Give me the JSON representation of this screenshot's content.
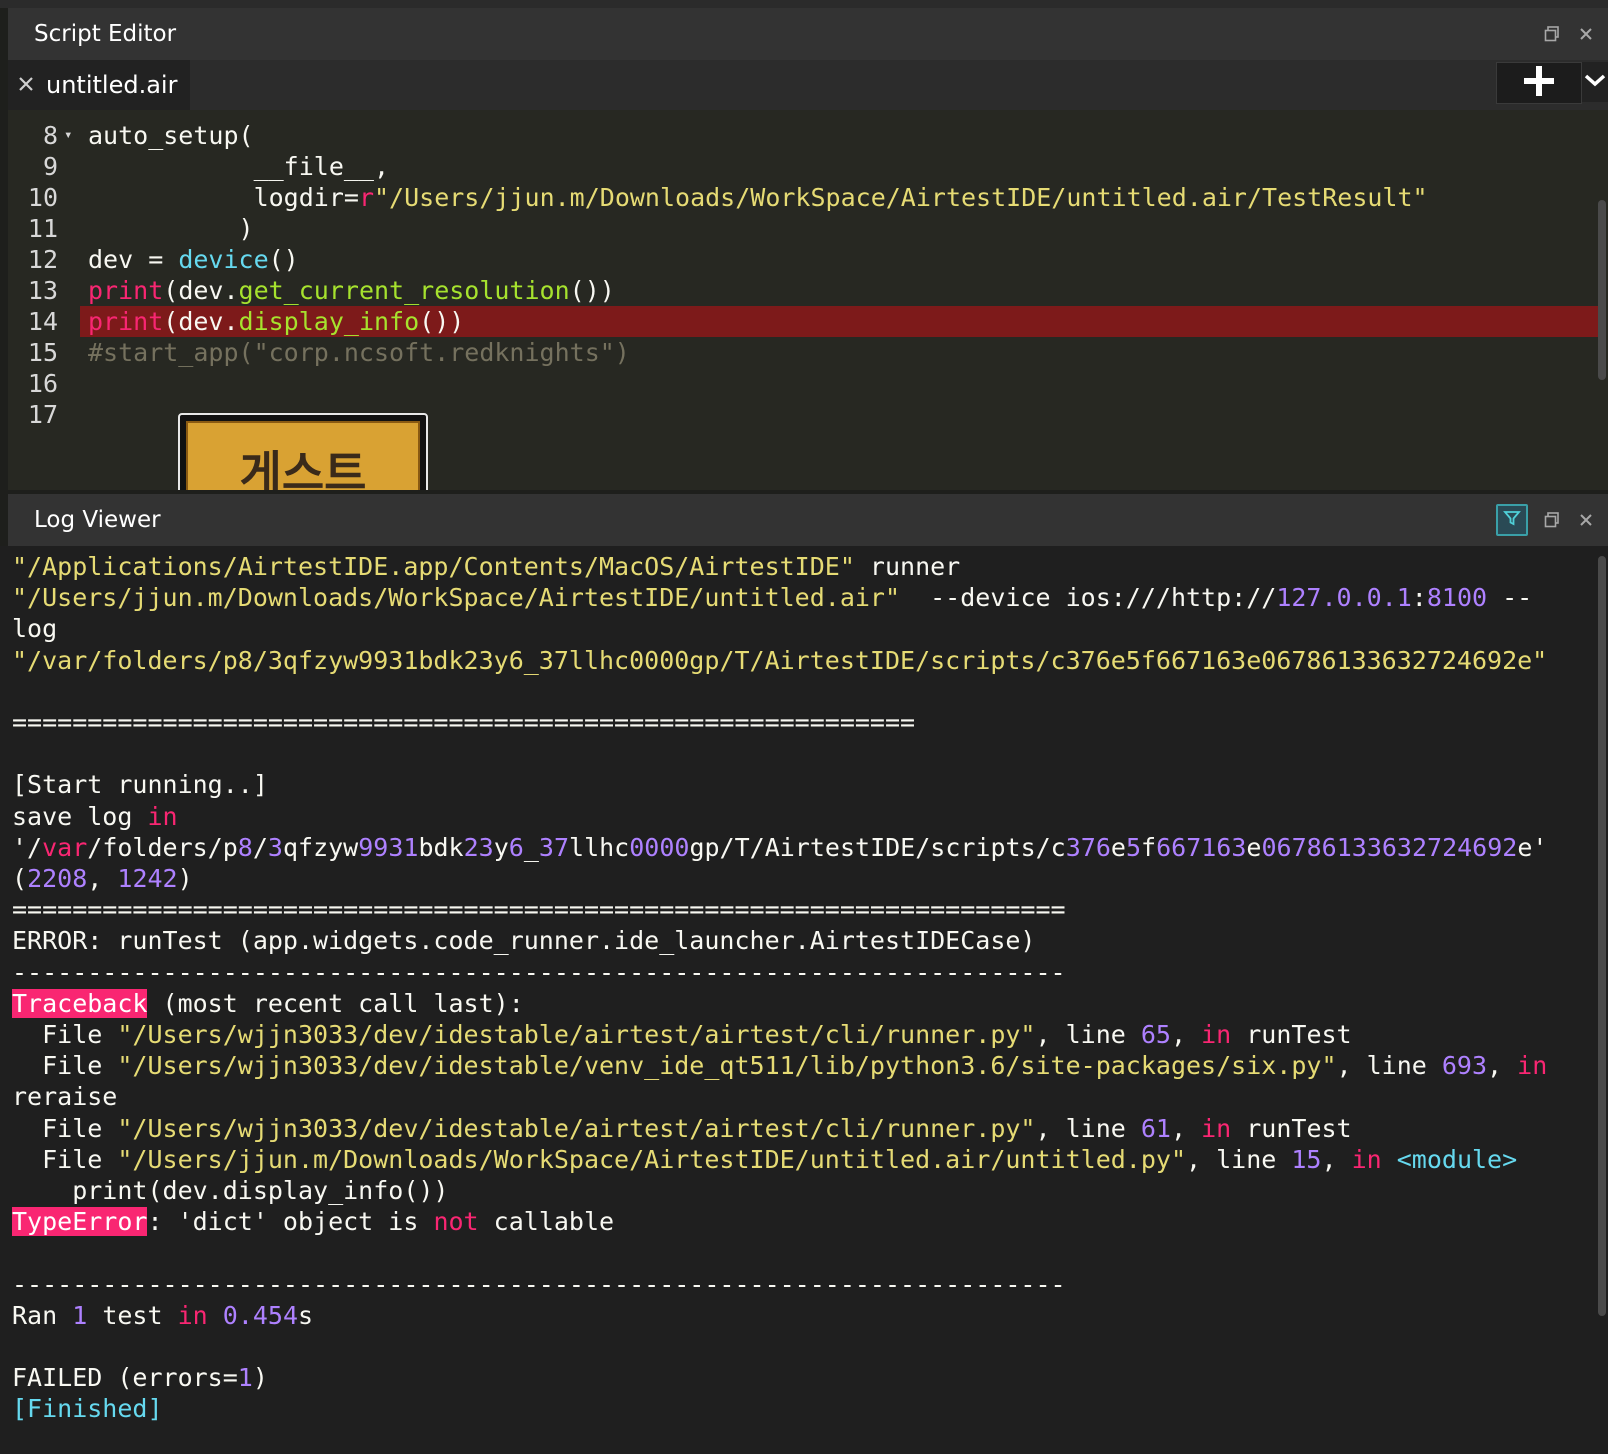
{
  "window": {
    "script_editor_title": "Script Editor",
    "log_viewer_title": "Log Viewer"
  },
  "editor": {
    "tab_label": "untitled.air",
    "lines": [
      {
        "num": "8",
        "fold": "▾",
        "tokens": [
          [
            "c-plain",
            "auto_setup("
          ]
        ]
      },
      {
        "num": "9",
        "tokens": [
          [
            "c-plain",
            "           __file__,"
          ]
        ]
      },
      {
        "num": "10",
        "tokens": [
          [
            "c-plain",
            "           logdir="
          ],
          [
            "c-kw",
            "r"
          ],
          [
            "c-str",
            "\"/Users/jjun.m/Downloads/WorkSpace/AirtestIDE/untitled.air/TestResult\""
          ]
        ]
      },
      {
        "num": "11",
        "tokens": [
          [
            "c-plain",
            "          )"
          ]
        ]
      },
      {
        "num": "12",
        "tokens": [
          [
            "c-plain",
            "dev = "
          ],
          [
            "c-bi",
            "device"
          ],
          [
            "c-plain",
            "()"
          ]
        ]
      },
      {
        "num": "13",
        "tokens": [
          [
            "c-kw",
            "print"
          ],
          [
            "c-plain",
            "(dev."
          ],
          [
            "c-fn",
            "get_current_resolution"
          ],
          [
            "c-plain",
            "())"
          ]
        ]
      },
      {
        "num": "14",
        "highlight": true,
        "tokens": [
          [
            "c-kw",
            "print"
          ],
          [
            "c-plain",
            "(dev."
          ],
          [
            "c-fn",
            "display_info"
          ],
          [
            "c-plain",
            "())"
          ]
        ]
      },
      {
        "num": "15",
        "tokens": [
          [
            "c-cmt",
            "#start_app(\"corp.ncsoft.redknights\")"
          ]
        ]
      },
      {
        "num": "16",
        "tokens": []
      },
      {
        "num": "17",
        "tokens": []
      }
    ],
    "image_preview_text": "게스트"
  },
  "log": {
    "lines": [
      [
        [
          "l-str",
          "\"/Applications/AirtestIDE.app/Contents/MacOS/AirtestIDE\""
        ],
        [
          "",
          " runner"
        ]
      ],
      [
        [
          "l-str",
          "\"/Users/jjun.m/Downloads/WorkSpace/AirtestIDE/untitled.air\""
        ],
        [
          "",
          "  --device ios:///http://"
        ],
        [
          "l-num",
          "127.0.0.1"
        ],
        [
          "",
          ":"
        ],
        [
          "l-num",
          "8100"
        ],
        [
          "",
          " --"
        ]
      ],
      [
        [
          "",
          "log"
        ]
      ],
      [
        [
          "l-str",
          "\"/var/folders/p8/3qfzyw9931bdk23y6_37llhc0000gp/T/AirtestIDE/scripts/c376e5f667163e06786133632724692e\""
        ]
      ],
      [],
      [
        [
          "",
          "============================================================"
        ]
      ],
      [],
      [
        [
          "",
          "[Start running..]"
        ]
      ],
      [
        [
          "",
          "save log "
        ],
        [
          "l-kw",
          "in"
        ]
      ],
      [
        [
          "",
          "'/"
        ],
        [
          "l-kw",
          "var"
        ],
        [
          "",
          "/folders/p"
        ],
        [
          "l-num",
          "8"
        ],
        [
          "",
          "/"
        ],
        [
          "l-num",
          "3"
        ],
        [
          "",
          "qfzyw"
        ],
        [
          "l-num",
          "9931"
        ],
        [
          "",
          "bdk"
        ],
        [
          "l-num",
          "23"
        ],
        [
          "",
          "y"
        ],
        [
          "l-num",
          "6"
        ],
        [
          "",
          "_"
        ],
        [
          "l-num",
          "37"
        ],
        [
          "",
          "llhc"
        ],
        [
          "l-num",
          "0000"
        ],
        [
          "",
          "gp/T/AirtestIDE/scripts/c"
        ],
        [
          "l-num",
          "376"
        ],
        [
          "",
          "e"
        ],
        [
          "l-num",
          "5"
        ],
        [
          "",
          "f"
        ],
        [
          "l-num",
          "667163"
        ],
        [
          "",
          "e"
        ],
        [
          "l-num",
          "06786133632724692"
        ],
        [
          "",
          "e'"
        ]
      ],
      [
        [
          "",
          "("
        ],
        [
          "l-num",
          "2208"
        ],
        [
          "",
          ", "
        ],
        [
          "l-num",
          "1242"
        ],
        [
          "",
          ")"
        ]
      ],
      [
        [
          "",
          "======================================================================"
        ]
      ],
      [
        [
          "",
          "ERROR: runTest (app.widgets.code_runner.ide_launcher.AirtestIDECase)"
        ]
      ],
      [
        [
          "",
          "----------------------------------------------------------------------"
        ]
      ],
      [
        [
          "l-err",
          "Traceback"
        ],
        [
          "",
          " (most recent call last):"
        ]
      ],
      [
        [
          "",
          "  File "
        ],
        [
          "l-str",
          "\"/Users/wjjn3033/dev/idestable/airtest/airtest/cli/runner.py\""
        ],
        [
          "",
          ", line "
        ],
        [
          "l-num",
          "65"
        ],
        [
          "",
          ", "
        ],
        [
          "l-kw",
          "in"
        ],
        [
          "",
          " runTest"
        ]
      ],
      [
        [
          "",
          "  File "
        ],
        [
          "l-str",
          "\"/Users/wjjn3033/dev/idestable/venv_ide_qt511/lib/python3.6/site-packages/six.py\""
        ],
        [
          "",
          ", line "
        ],
        [
          "l-num",
          "693"
        ],
        [
          "",
          ", "
        ],
        [
          "l-kw",
          "in"
        ]
      ],
      [
        [
          "",
          "reraise"
        ]
      ],
      [
        [
          "",
          "  File "
        ],
        [
          "l-str",
          "\"/Users/wjjn3033/dev/idestable/airtest/airtest/cli/runner.py\""
        ],
        [
          "",
          ", line "
        ],
        [
          "l-num",
          "61"
        ],
        [
          "",
          ", "
        ],
        [
          "l-kw",
          "in"
        ],
        [
          "",
          " runTest"
        ]
      ],
      [
        [
          "",
          "  File "
        ],
        [
          "l-str",
          "\"/Users/jjun.m/Downloads/WorkSpace/AirtestIDE/untitled.air/untitled.py\""
        ],
        [
          "",
          ", line "
        ],
        [
          "l-num",
          "15"
        ],
        [
          "",
          ", "
        ],
        [
          "l-kw",
          "in"
        ],
        [
          "",
          " "
        ],
        [
          "l-cyan",
          "<module>"
        ]
      ],
      [
        [
          "",
          "    print(dev.display_info())"
        ]
      ],
      [
        [
          "l-err",
          "TypeError"
        ],
        [
          "",
          ": 'dict' object is "
        ],
        [
          "l-kw",
          "not"
        ],
        [
          "",
          " callable"
        ]
      ],
      [],
      [
        [
          "",
          "----------------------------------------------------------------------"
        ]
      ],
      [
        [
          "",
          "Ran "
        ],
        [
          "l-num",
          "1"
        ],
        [
          "",
          " test "
        ],
        [
          "l-kw",
          "in"
        ],
        [
          "",
          " "
        ],
        [
          "l-num",
          "0.454"
        ],
        [
          "",
          "s"
        ]
      ],
      [],
      [
        [
          "",
          "FAILED (errors="
        ],
        [
          "l-num",
          "1"
        ],
        [
          "",
          ")"
        ]
      ],
      [
        [
          "l-cyan",
          "[Finished]"
        ]
      ]
    ]
  },
  "icons": {
    "tab_close": "close-icon",
    "add": "plus-icon",
    "dropdown": "chevron-down-icon",
    "restore": "restore-window-icon",
    "close_panel": "close-icon",
    "filter": "filter-icon"
  },
  "colors": {
    "highlight_line": "#7d1a1a",
    "error_badge": "#f92672",
    "keyword": "#f92672",
    "string": "#e6db74",
    "number": "#ae81ff",
    "function": "#a6e22e",
    "builtin": "#66d9ef"
  }
}
